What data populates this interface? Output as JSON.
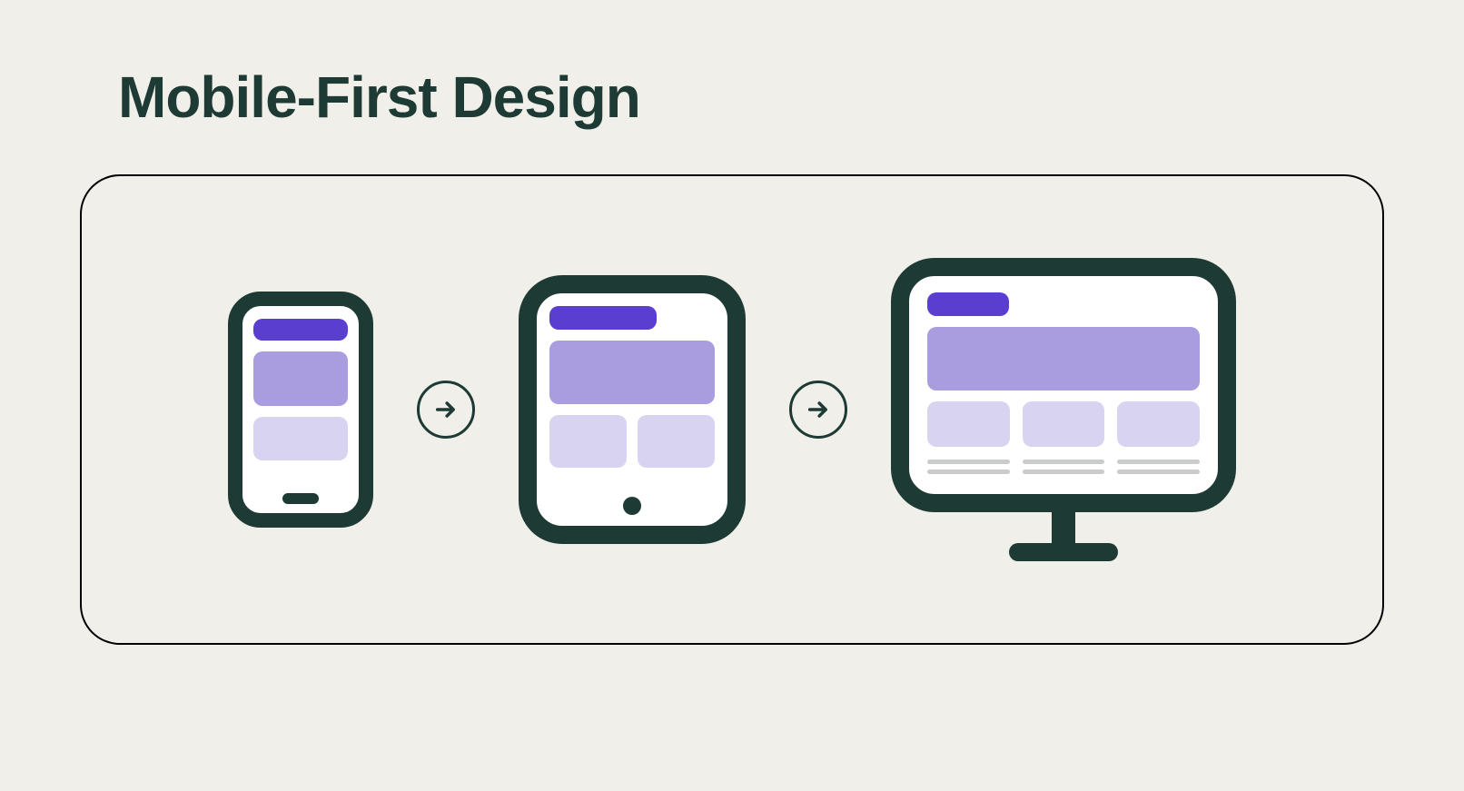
{
  "title": "Mobile-First Design",
  "colors": {
    "background": "#f1efe9",
    "ink": "#1e3a34",
    "purple_dark": "#5a3ecf",
    "purple_mid": "#a99de0",
    "purple_light": "#d8d3f0"
  },
  "flow": {
    "stages": [
      "mobile",
      "tablet",
      "desktop"
    ],
    "arrow_icon": "arrow-right"
  },
  "devices": {
    "mobile": {
      "name": "phone",
      "columns": 1,
      "cards": 1
    },
    "tablet": {
      "name": "tablet",
      "columns": 2,
      "cards": 2
    },
    "desktop": {
      "name": "desktop",
      "columns": 3,
      "cards": 3,
      "text_lines_per_card": 2
    }
  }
}
